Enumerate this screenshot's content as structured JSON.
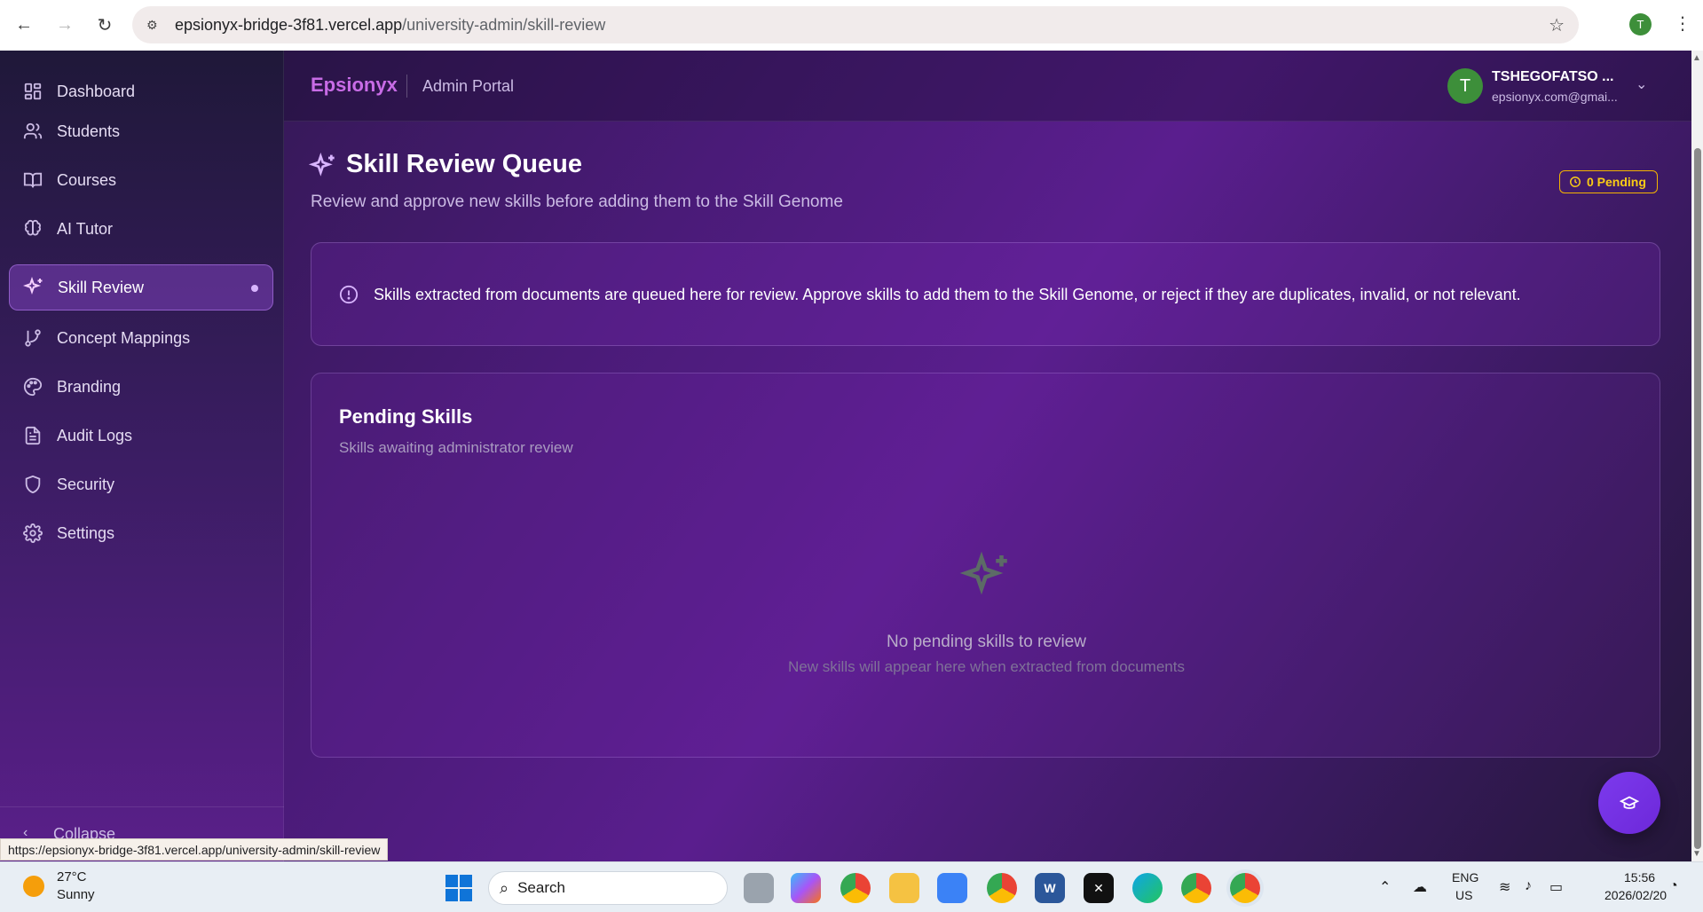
{
  "browser": {
    "url_host": "epsionyx-bridge-3f81.vercel.app",
    "url_path": "/university-admin/skill-review",
    "profile_initial": "T",
    "status_url": "https://epsionyx-bridge-3f81.vercel.app/university-admin/skill-review"
  },
  "sidebar": {
    "items": [
      {
        "label": "Dashboard",
        "icon": "grid-icon"
      },
      {
        "label": "Students",
        "icon": "users-icon"
      },
      {
        "label": "Courses",
        "icon": "book-icon"
      },
      {
        "label": "AI Tutor",
        "icon": "brain-icon"
      },
      {
        "label": "Skill Review",
        "icon": "sparkles-icon",
        "active": true
      },
      {
        "label": "Concept Mappings",
        "icon": "git-branch-icon"
      },
      {
        "label": "Branding",
        "icon": "palette-icon"
      },
      {
        "label": "Audit Logs",
        "icon": "file-text-icon"
      },
      {
        "label": "Security",
        "icon": "shield-icon"
      },
      {
        "label": "Settings",
        "icon": "gear-icon"
      }
    ],
    "collapse_label": "Collapse"
  },
  "header": {
    "brand": "Epsionyx",
    "portal": "Admin Portal",
    "user_initial": "T",
    "user_name": "TSHEGOFATSO ...",
    "user_email": "epsionyx.com@gmai..."
  },
  "page": {
    "title": "Skill Review Queue",
    "subtitle": "Review and approve new skills before adding them to the Skill Genome",
    "pending_badge": "0 Pending",
    "info_text": "Skills extracted from documents are queued here for review. Approve skills to add them to the Skill Genome, or reject if they are duplicates, invalid, or not relevant.",
    "card_title": "Pending Skills",
    "card_subtitle": "Skills awaiting administrator review",
    "empty_title": "No pending skills to review",
    "empty_subtitle": "New skills will appear here when extracted from documents"
  },
  "taskbar": {
    "temp": "27°C",
    "condition": "Sunny",
    "search_label": "Search",
    "lang_top": "ENG",
    "lang_bottom": "US",
    "time": "15:56",
    "date": "2026/02/20"
  },
  "colors": {
    "brand": "#c86ce6",
    "accent": "#a855f7",
    "badge": "#facc15"
  }
}
